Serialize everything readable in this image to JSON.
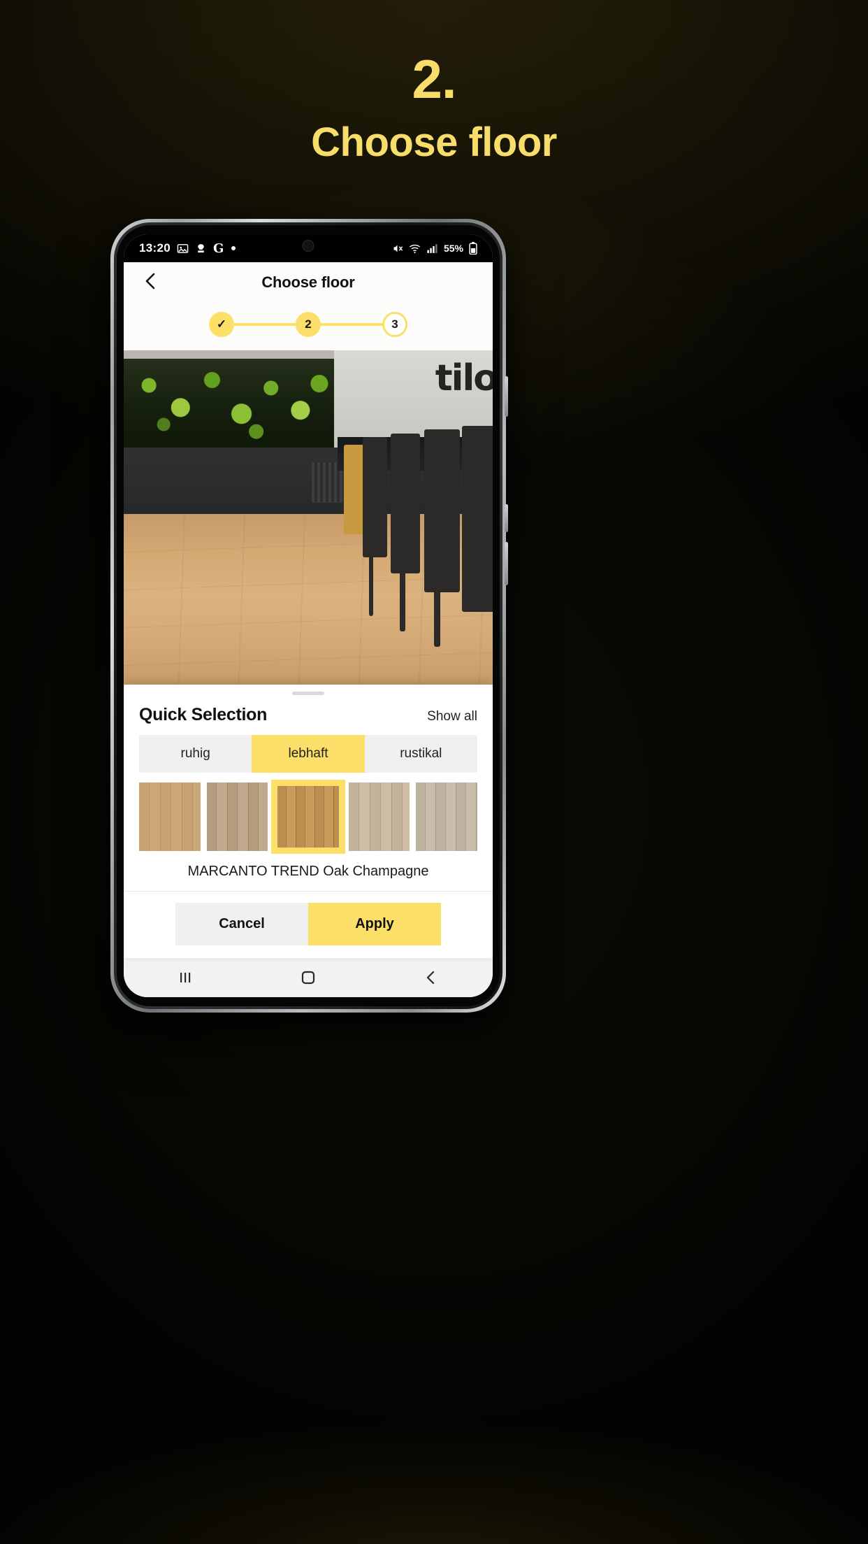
{
  "promo": {
    "step_number": "2.",
    "title": "Choose floor",
    "accent_color": "#f9dd6a",
    "background_color": "#4a4114"
  },
  "phone": {
    "status_bar": {
      "time": "13:20",
      "left_icons": [
        "image-icon",
        "app-icon",
        "google-icon",
        "dot-icon"
      ],
      "right_icons": [
        "mute-icon",
        "wifi-icon",
        "signal-icon"
      ],
      "battery_percent": "55%"
    },
    "app_bar": {
      "back_icon": "chevron-left-icon",
      "title": "Choose floor"
    },
    "stepper": {
      "steps": [
        {
          "label": "✓",
          "state": "done"
        },
        {
          "label": "2",
          "state": "current"
        },
        {
          "label": "3",
          "state": "upcoming"
        }
      ],
      "accent_color": "#fbdf68"
    },
    "photo": {
      "brand_logo": "tilo",
      "alt": "interior room with wooden floor, green plant wall and bar stools"
    },
    "sheet": {
      "title": "Quick Selection",
      "show_all_label": "Show all",
      "segments": [
        {
          "label": "ruhig",
          "active": false
        },
        {
          "label": "lebhaft",
          "active": true
        },
        {
          "label": "rustikal",
          "active": false
        }
      ],
      "swatches": [
        {
          "name": "swatch-1",
          "selected": false
        },
        {
          "name": "swatch-2",
          "selected": false
        },
        {
          "name": "swatch-3",
          "selected": true
        },
        {
          "name": "swatch-4",
          "selected": false
        },
        {
          "name": "swatch-5",
          "selected": false
        }
      ],
      "product_name": "MARCANTO TREND Oak Champagne",
      "cancel_label": "Cancel",
      "apply_label": "Apply"
    },
    "nav_bar": {
      "recents_icon": "recents-icon",
      "home_icon": "home-icon",
      "back_icon": "back-icon"
    }
  }
}
